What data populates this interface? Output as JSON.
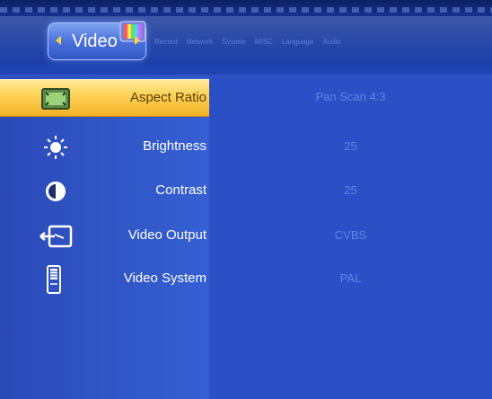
{
  "header": {
    "active_tab": "Video",
    "tabs": [
      "Record",
      "Network",
      "System",
      "MISC",
      "Language",
      "Audio"
    ]
  },
  "settings": [
    {
      "label": "Aspect Ratio",
      "value": "Pan Scan 4:3",
      "icon": "aspect-ratio-icon",
      "selected": true
    },
    {
      "label": "Brightness",
      "value": "25",
      "icon": "brightness-icon",
      "selected": false
    },
    {
      "label": "Contrast",
      "value": "25",
      "icon": "contrast-icon",
      "selected": false
    },
    {
      "label": "Video Output",
      "value": "CVBS",
      "icon": "video-output-icon",
      "selected": false
    },
    {
      "label": "Video System",
      "value": "PAL",
      "icon": "video-system-icon",
      "selected": false
    }
  ],
  "colors": {
    "selected_bar": "#ffd35a",
    "panel": "#2b50c6",
    "value_text": "#5f84e2"
  }
}
